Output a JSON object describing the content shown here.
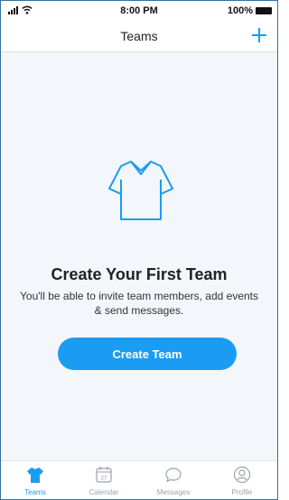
{
  "status_bar": {
    "time": "8:00 PM",
    "battery": "100%"
  },
  "nav": {
    "title": "Teams",
    "add_icon": "plus-icon"
  },
  "empty_state": {
    "icon": "shirt-icon",
    "heading": "Create Your First Team",
    "description": "You'll be able to invite team members, add events & send messages.",
    "button_label": "Create Team"
  },
  "tabs": [
    {
      "label": "Teams",
      "icon": "jersey-icon",
      "active": true
    },
    {
      "label": "Calendar",
      "icon": "calendar-icon",
      "day": "27",
      "active": false
    },
    {
      "label": "Messages",
      "icon": "speech-bubble-icon",
      "active": false
    },
    {
      "label": "Profile",
      "icon": "profile-icon",
      "active": false
    }
  ],
  "colors": {
    "accent": "#1a9cf2",
    "background": "#f3f6fb",
    "inactive": "#9aa2ab"
  }
}
